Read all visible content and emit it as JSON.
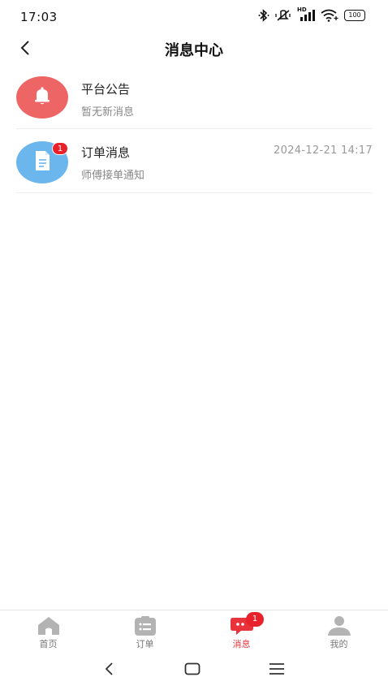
{
  "status_bar": {
    "time": "17:03",
    "icons": [
      "bluetooth-icon",
      "mute-vibrate-icon",
      "hd-signal-icon",
      "wifi-icon",
      "battery-icon"
    ],
    "signal_label": "HD",
    "battery_level": "100"
  },
  "header": {
    "title": "消息中心",
    "back_icon": "chevron-left-icon"
  },
  "messages": [
    {
      "title": "平台公告",
      "subtitle": "暂无新消息",
      "time": "",
      "badge": "",
      "icon": "bell-icon",
      "color": "#ee6565"
    },
    {
      "title": "订单消息",
      "subtitle": "师傅接单通知",
      "time": "2024-12-21 14:17",
      "badge": "1",
      "icon": "document-icon",
      "color": "#6cb6ee"
    }
  ],
  "tab_bar": {
    "tabs": [
      {
        "label": "首页",
        "icon": "home-icon",
        "active": false,
        "badge": ""
      },
      {
        "label": "订单",
        "icon": "order-list-icon",
        "active": false,
        "badge": ""
      },
      {
        "label": "消息",
        "icon": "message-icon",
        "active": true,
        "badge": "1"
      },
      {
        "label": "我的",
        "icon": "user-icon",
        "active": false,
        "badge": ""
      }
    ],
    "active_color": "#e8323c",
    "inactive_color": "#777777"
  },
  "system_nav": {
    "buttons": [
      "back-nav-icon",
      "home-nav-icon",
      "menu-nav-icon"
    ]
  }
}
